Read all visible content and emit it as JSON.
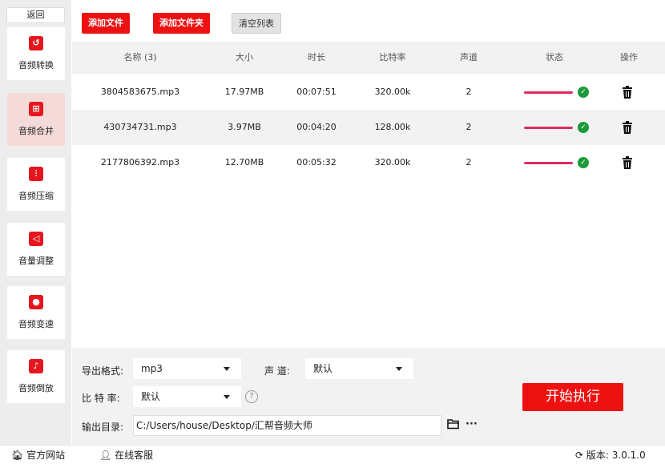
{
  "sidebar": {
    "back_label": "返回",
    "items": [
      {
        "label": "音频转换",
        "icon": "audio-convert-icon",
        "glyph": "↺"
      },
      {
        "label": "音频合并",
        "icon": "audio-merge-icon",
        "glyph": "⊞"
      },
      {
        "label": "音频压缩",
        "icon": "audio-compress-icon",
        "glyph": "⫶"
      },
      {
        "label": "音量调整",
        "icon": "volume-icon",
        "glyph": "◁"
      },
      {
        "label": "音频变速",
        "icon": "microphone-icon",
        "glyph": "●"
      },
      {
        "label": "音频倒放",
        "icon": "music-note-icon",
        "glyph": "♪"
      }
    ]
  },
  "toolbar": {
    "add_file_label": "添加文件",
    "add_folder_label": "添加文件夹",
    "clear_list_label": "清空列表"
  },
  "table": {
    "headers": [
      "名称 (3)",
      "大小",
      "时长",
      "比特率",
      "声道",
      "状态",
      "操作"
    ],
    "rows": [
      {
        "name": "3804583675.mp3",
        "size": "17.97MB",
        "duration": "00:07:51",
        "bitrate": "320.00k",
        "channels": "2",
        "progress": 1.0
      },
      {
        "name": "430734731.mp3",
        "size": "3.97MB",
        "duration": "00:04:20",
        "bitrate": "128.00k",
        "channels": "2",
        "progress": 1.0
      },
      {
        "name": "2177806392.mp3",
        "size": "12.70MB",
        "duration": "00:05:32",
        "bitrate": "320.00k",
        "channels": "2",
        "progress": 1.0
      }
    ]
  },
  "settings": {
    "format_label": "导出格式:",
    "format_value": "mp3",
    "channel_label": "声 道:",
    "channel_value": "默认",
    "bitrate_label": "比 特 率:",
    "bitrate_value": "默认",
    "help_glyph": "?",
    "output_label": "输出目录:",
    "output_path": "C:/Users/house/Desktop/汇帮音频大师",
    "more_glyph": "···",
    "start_label": "开始执行"
  },
  "footer": {
    "website_label": "官方网站",
    "support_label": "在线客服",
    "version_label": "版本: 3.0.1.0"
  },
  "colors": {
    "accent": "#ee1111",
    "progress": "#e02b5f",
    "success": "#1a9a3a",
    "active_nav": "#f5dada"
  }
}
